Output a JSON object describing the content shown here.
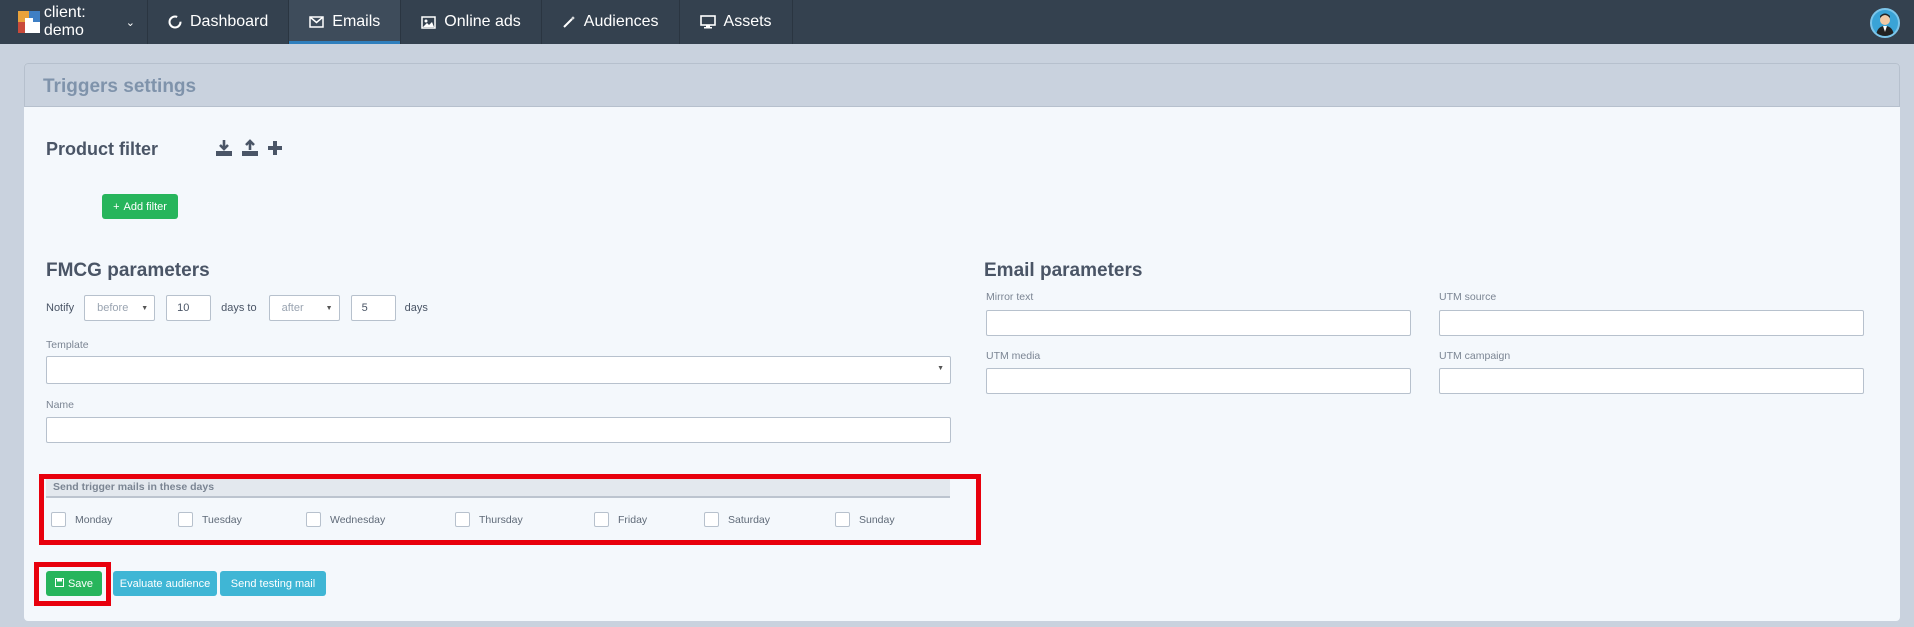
{
  "nav": {
    "client_label": "client: demo",
    "tabs": [
      {
        "label": "Dashboard",
        "icon": "circle-notch-icon"
      },
      {
        "label": "Emails",
        "icon": "envelope-icon"
      },
      {
        "label": "Online ads",
        "icon": "image-icon"
      },
      {
        "label": "Audiences",
        "icon": "magic-wand-icon"
      },
      {
        "label": "Assets",
        "icon": "monitor-icon"
      }
    ],
    "active_tab": "Emails"
  },
  "panel": {
    "title": "Triggers settings"
  },
  "product_filter": {
    "heading": "Product filter",
    "add_filter_label": "Add filter"
  },
  "fmcg": {
    "heading": "FMCG parameters",
    "notify_label": "Notify",
    "before_value": "before",
    "days_value_1": "10",
    "days_to_label": "days to",
    "after_value": "after",
    "days_value_2": "5",
    "days_label": "days",
    "template_label": "Template",
    "template_value": "",
    "name_label": "Name",
    "name_value": ""
  },
  "email_params": {
    "heading": "Email parameters",
    "mirror_text_label": "Mirror text",
    "utm_source_label": "UTM source",
    "utm_media_label": "UTM media",
    "utm_campaign_label": "UTM campaign"
  },
  "days": {
    "title": "Send trigger mails in these days",
    "items": [
      "Monday",
      "Tuesday",
      "Wednesday",
      "Thursday",
      "Friday",
      "Saturday",
      "Sunday"
    ]
  },
  "actions": {
    "save_label": "Save",
    "evaluate_label": "Evaluate audience",
    "testing_label": "Send testing mail"
  },
  "colors": {
    "nav_bg": "#34414f",
    "accent_green": "#27b55c",
    "accent_blue": "#3fb6d5",
    "highlight_red": "#e8000d"
  }
}
